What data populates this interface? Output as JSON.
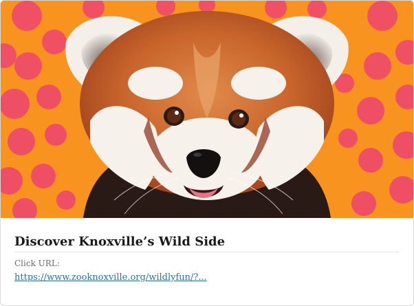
{
  "card": {
    "title": "Discover Knoxville’s Wild Side",
    "url_label": "Click URL:",
    "url_text": "https://www.zooknoxville.org/wildlyfun/?...",
    "image_alt": "Red panda",
    "image_subject": "red-panda"
  },
  "colors": {
    "background_orange": "#f7931e",
    "dot_pink": "#ef4a6a",
    "link_blue": "#2a6ebb"
  }
}
